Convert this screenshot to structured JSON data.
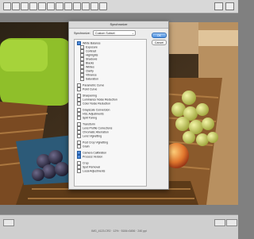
{
  "toolbar": {
    "right_text": "Done"
  },
  "bottom_bar": {
    "info": "IMG_4123.CR2 · 12% · 5184×3456 · 240 ppi"
  },
  "dialog": {
    "title": "Synchronize",
    "sync_label": "Synchronize:",
    "sync_value": "Custom Subset",
    "ok_label": "OK",
    "cancel_label": "Cancel",
    "items": [
      {
        "label": "White Balance",
        "checked": true,
        "indent": false
      },
      {
        "label": "Exposure",
        "checked": false,
        "indent": true
      },
      {
        "label": "Contrast",
        "checked": false,
        "indent": true
      },
      {
        "label": "Highlights",
        "checked": false,
        "indent": true
      },
      {
        "label": "Shadows",
        "checked": false,
        "indent": true
      },
      {
        "label": "Blacks",
        "checked": false,
        "indent": true
      },
      {
        "label": "Whites",
        "checked": false,
        "indent": true
      },
      {
        "label": "Clarity",
        "checked": false,
        "indent": true
      },
      {
        "label": "Vibrance",
        "checked": false,
        "indent": true
      },
      {
        "label": "Saturation",
        "checked": false,
        "indent": true
      },
      {
        "label": "",
        "checked": false,
        "indent": false,
        "spacer": true
      },
      {
        "label": "Parametric Curve",
        "checked": false,
        "indent": false
      },
      {
        "label": "Point Curve",
        "checked": false,
        "indent": false
      },
      {
        "label": "",
        "checked": false,
        "indent": false,
        "spacer": true
      },
      {
        "label": "Sharpening",
        "checked": false,
        "indent": false
      },
      {
        "label": "Luminance Noise Reduction",
        "checked": false,
        "indent": false
      },
      {
        "label": "Color Noise Reduction",
        "checked": false,
        "indent": false
      },
      {
        "label": "",
        "checked": false,
        "indent": false,
        "spacer": true
      },
      {
        "label": "Grayscale Conversion",
        "checked": false,
        "indent": false
      },
      {
        "label": "HSL Adjustments",
        "checked": false,
        "indent": false
      },
      {
        "label": "Split Toning",
        "checked": false,
        "indent": false
      },
      {
        "label": "",
        "checked": false,
        "indent": false,
        "spacer": true
      },
      {
        "label": "Transform",
        "checked": false,
        "indent": false
      },
      {
        "label": "Lens Profile Corrections",
        "checked": false,
        "indent": false
      },
      {
        "label": "Chromatic Aberration",
        "checked": false,
        "indent": false
      },
      {
        "label": "Lens Vignetting",
        "checked": false,
        "indent": false
      },
      {
        "label": "",
        "checked": false,
        "indent": false,
        "spacer": true
      },
      {
        "label": "Post Crop Vignetting",
        "checked": false,
        "indent": false
      },
      {
        "label": "Grain",
        "checked": false,
        "indent": false
      },
      {
        "label": "",
        "checked": false,
        "indent": false,
        "spacer": true
      },
      {
        "label": "Camera Calibration",
        "checked": true,
        "indent": false
      },
      {
        "label": "Process Version",
        "checked": true,
        "indent": false
      },
      {
        "label": "",
        "checked": false,
        "indent": false,
        "spacer": true
      },
      {
        "label": "Crop",
        "checked": false,
        "indent": false
      },
      {
        "label": "Spot Removal",
        "checked": false,
        "indent": false
      },
      {
        "label": "Local Adjustments",
        "checked": false,
        "indent": false
      }
    ]
  },
  "colors": {
    "accent": "#3d7fd6",
    "dialog_bg": "#ececec"
  }
}
